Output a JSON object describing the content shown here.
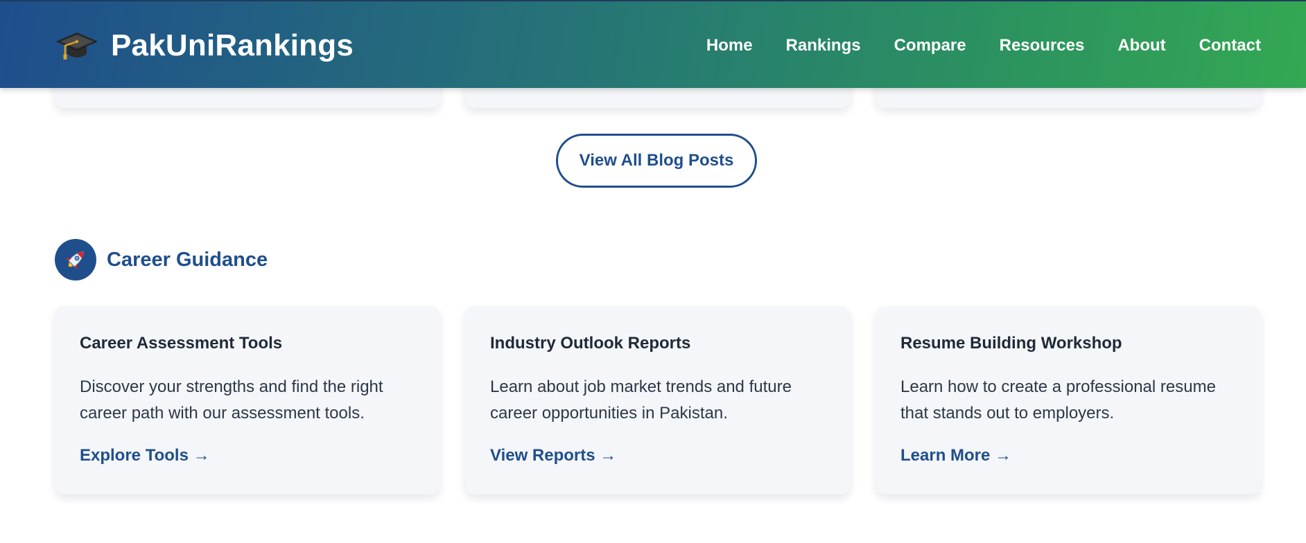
{
  "header": {
    "brand_name": "PakUniRankings",
    "brand_icon": "graduation-cap-icon",
    "nav": [
      {
        "label": "Home"
      },
      {
        "label": "Rankings"
      },
      {
        "label": "Compare"
      },
      {
        "label": "Resources"
      },
      {
        "label": "About"
      },
      {
        "label": "Contact"
      }
    ]
  },
  "blog": {
    "view_all_label": "View All Blog Posts"
  },
  "career": {
    "icon": "rocket-icon",
    "title": "Career Guidance",
    "cards": [
      {
        "title": "Career Assessment Tools",
        "description": "Discover your strengths and find the right career path with our assessment tools.",
        "link": "Explore Tools →"
      },
      {
        "title": "Industry Outlook Reports",
        "description": "Learn about job market trends and future career opportunities in Pakistan.",
        "link": "View Reports →"
      },
      {
        "title": "Resume Building Workshop",
        "description": "Learn how to create a professional resume that stands out to employers.",
        "link": "Learn More →"
      }
    ]
  },
  "colors": {
    "primary": "#1f4e8c",
    "accent_green": "#34a853",
    "card_bg": "#f4f6f9"
  }
}
